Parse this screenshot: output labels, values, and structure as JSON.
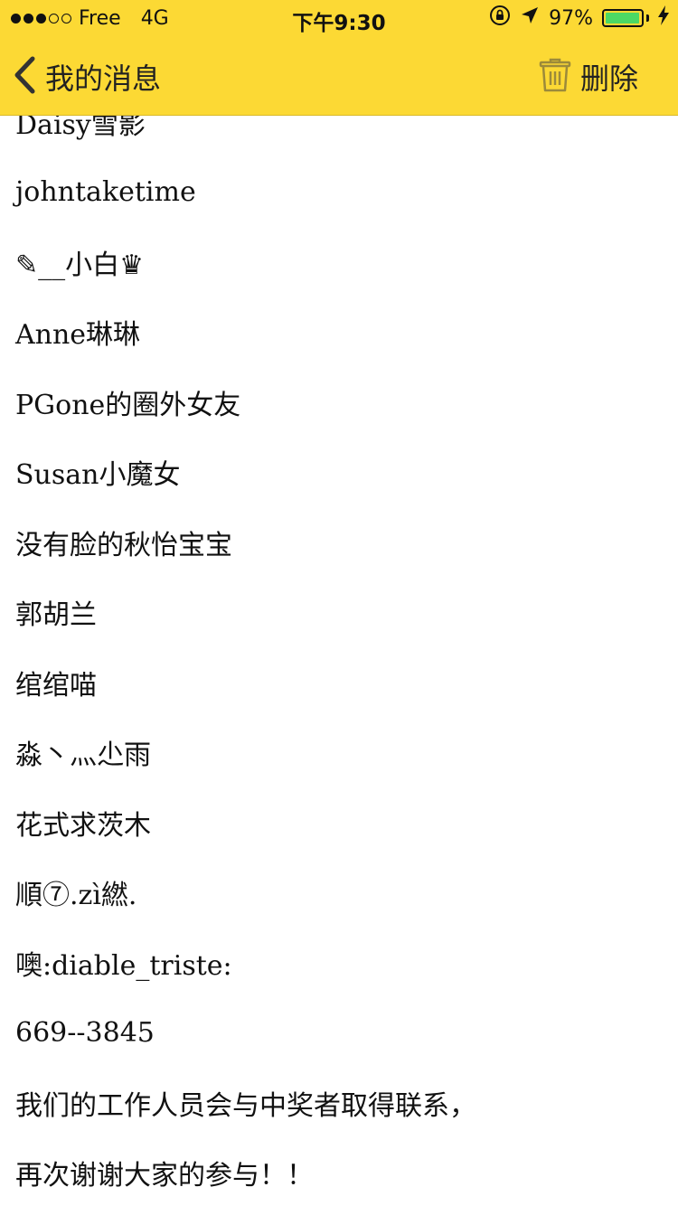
{
  "status_bar": {
    "carrier": "Free",
    "network": "4G",
    "time": "下午9:30",
    "battery_percent": "97%",
    "battery_level": 0.97,
    "battery_color": "#4cd964"
  },
  "nav": {
    "back_icon": "chevron-left-icon",
    "title": "我的消息",
    "delete_icon": "trash-icon",
    "delete_label": "删除",
    "bar_color": "#FCD934"
  },
  "messages": [
    "Daisy雪影",
    "johntaketime",
    "✎__小白♛",
    "Anne琳琳",
    "PGone的圈外女友",
    "Susan小魔女",
    "没有脸的秋怡宝宝",
    "郭胡兰",
    "绾绾喵",
    "淼丶灬尐雨",
    "花式求茨木",
    "順⑦.zì繎.",
    "噢:diable_triste:",
    "669--3845",
    "我们的工作人员会与中奖者取得联系，",
    "再次谢谢大家的参与！！"
  ]
}
